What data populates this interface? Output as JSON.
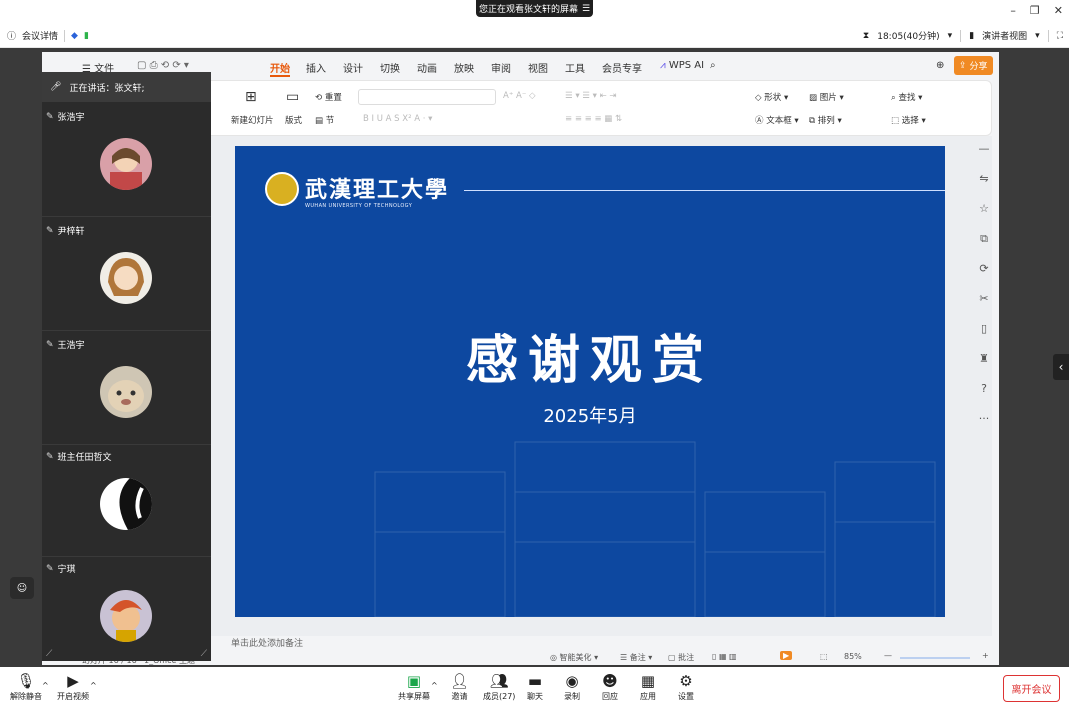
{
  "share_banner": "您正在观看张文轩的屏幕",
  "meeting": {
    "info_label": "会议详情",
    "timer": "18:05(40分钟)",
    "view_label": "演讲者视图"
  },
  "wps": {
    "file_menu": "文件",
    "tabs": [
      "开始",
      "插入",
      "设计",
      "切换",
      "动画",
      "放映",
      "审阅",
      "视图",
      "工具",
      "会员专享",
      "WPS AI"
    ],
    "active_tab": "开始",
    "share_button": "分享",
    "ribbon": {
      "new_slide": "新建幻灯片",
      "layout": "版式",
      "reset": "重置",
      "section": "节",
      "shape": "形状",
      "picture": "图片",
      "find": "查找",
      "textbox": "文本框",
      "arrange": "排列",
      "select": "选择"
    },
    "notes_placeholder": "单击此处添加备注",
    "status": {
      "slide_counter": "幻灯片 16 / 16",
      "theme": "1_Office 主题",
      "smart_beautify": "智能美化",
      "notes": "备注",
      "comments": "批注",
      "zoom": "85%"
    }
  },
  "slide": {
    "logo_cn": "武漢理工大學",
    "logo_en": "WUHAN UNIVERSITY OF TECHNOLOGY",
    "title": "感谢观赏",
    "date": "2025年5月"
  },
  "panel": {
    "speaking": "正在讲话：张文轩;",
    "participants": [
      {
        "name": "张浩宇",
        "avatar": "anime-character"
      },
      {
        "name": "尹梓轩",
        "avatar": "anime-character-2"
      },
      {
        "name": "王浩宇",
        "avatar": "cat"
      },
      {
        "name": "班主任田哲文",
        "avatar": "black-white"
      },
      {
        "name": "宁琪",
        "avatar": "cartoon-character"
      }
    ]
  },
  "toolbar": {
    "unmute": "解除静音",
    "video": "开启视频",
    "share": "共享屏幕",
    "invite": "邀请",
    "members": "成员(27)",
    "chat": "聊天",
    "record": "录制",
    "reaction": "回应",
    "apps": "应用",
    "settings": "设置",
    "leave": "离开会议"
  },
  "colors": {
    "slide_bg": "#0d48a0",
    "accent_orange": "#f08a24",
    "active_tab": "#e8590c",
    "leave_red": "#d33333"
  }
}
